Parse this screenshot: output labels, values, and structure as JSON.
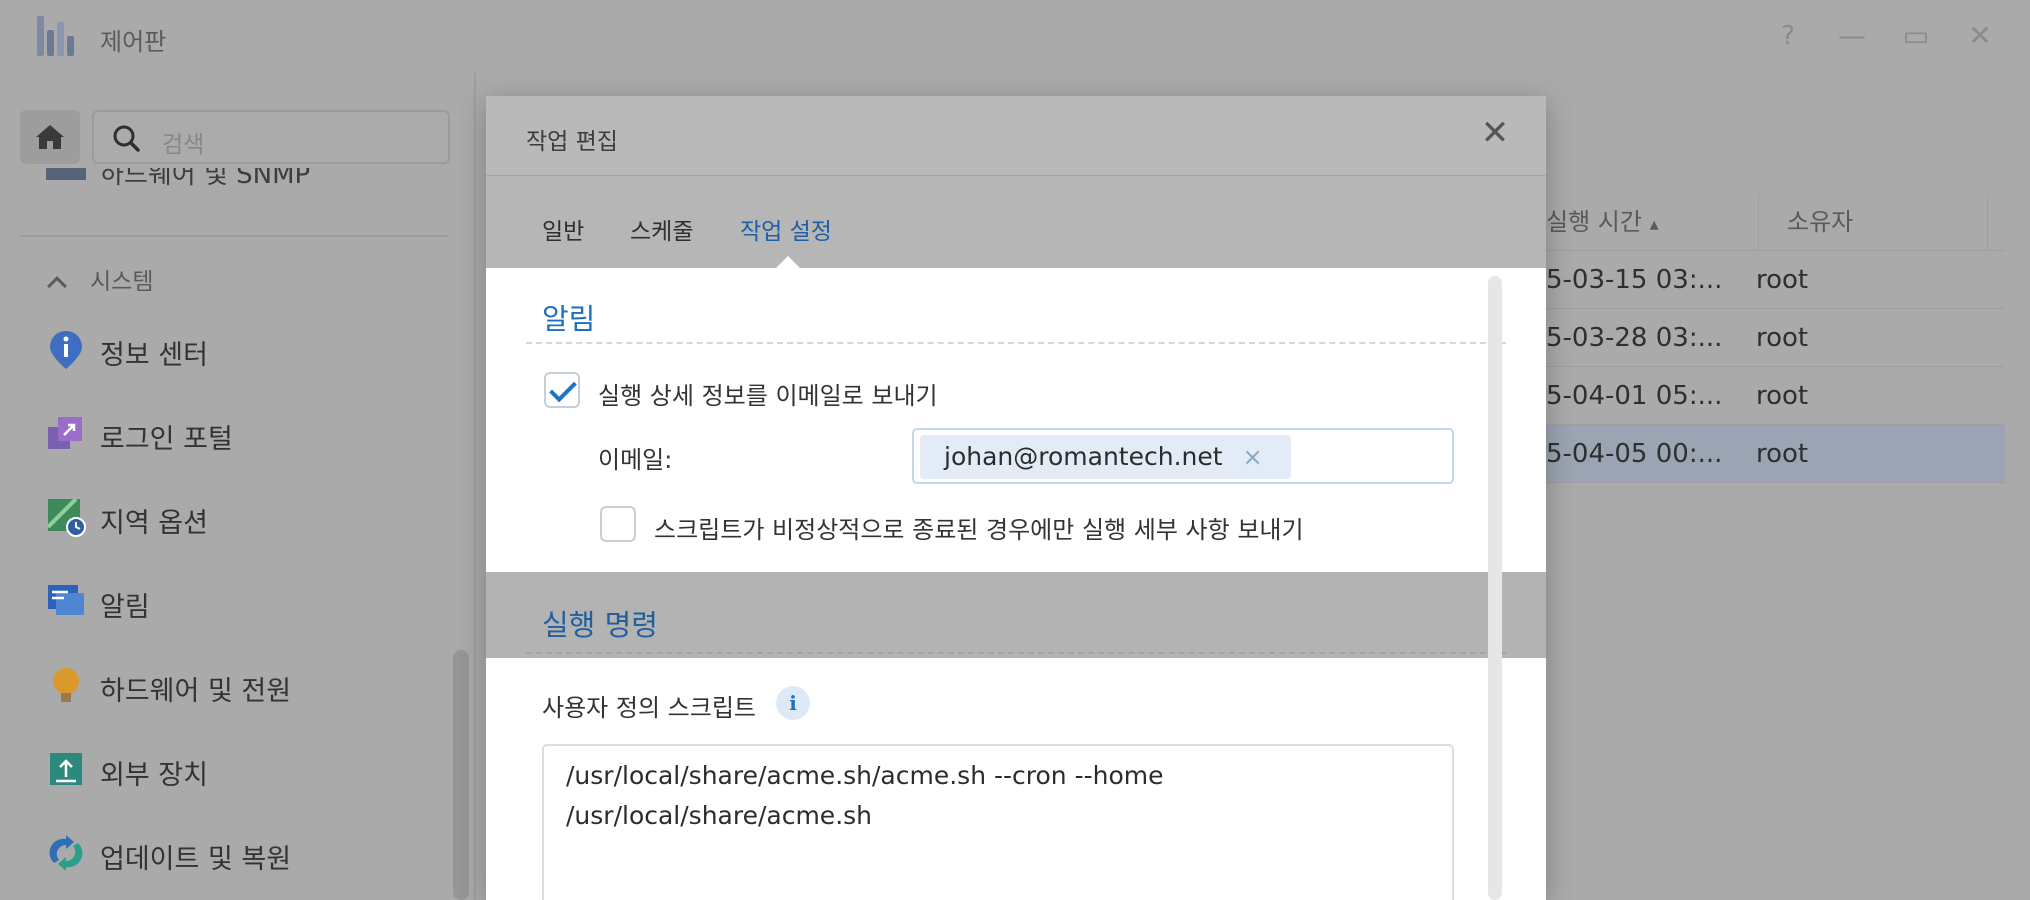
{
  "app": {
    "title": "제어판"
  },
  "window_controls": {
    "help": "?",
    "minimize": "—",
    "maximize": "▭",
    "close": "✕"
  },
  "sidebar": {
    "search_placeholder": "검색",
    "cut_item": "하드웨어 및 SNMP",
    "section": "시스템",
    "items": [
      {
        "label": "정보 센터",
        "icon": "info-pin-icon"
      },
      {
        "label": "로그인 포털",
        "icon": "login-portal-icon"
      },
      {
        "label": "지역 옵션",
        "icon": "regional-options-icon"
      },
      {
        "label": "알림",
        "icon": "notification-icon"
      },
      {
        "label": "하드웨어 및 전원",
        "icon": "hardware-power-icon"
      },
      {
        "label": "외부 장치",
        "icon": "external-devices-icon"
      },
      {
        "label": "업데이트 및 복원",
        "icon": "update-restore-icon"
      }
    ]
  },
  "table": {
    "columns": [
      "실행 시간",
      "소유자"
    ],
    "sort_indicator": "▴",
    "rows": [
      {
        "time": "5-03-15 03:...",
        "owner": "root"
      },
      {
        "time": "5-03-28 03:...",
        "owner": "root"
      },
      {
        "time": "5-04-01 05:...",
        "owner": "root"
      },
      {
        "time": "5-04-05 00:...",
        "owner": "root",
        "selected": true
      }
    ]
  },
  "modal": {
    "title": "작업 편집",
    "close": "✕",
    "tabs": [
      "일반",
      "스케줄",
      "작업 설정"
    ],
    "active_tab": "작업 설정",
    "notify": {
      "title": "알림",
      "send_email_label": "실행 상세 정보를 이메일로 보내기",
      "send_email_checked": true,
      "email_label": "이메일:",
      "email_value": "johan@romantech.net",
      "chip_remove": "×",
      "abnormal_only_label": "스크립트가 비정상적으로 종료된 경우에만 실행 세부 사항 보내기",
      "abnormal_only_checked": false
    },
    "command": {
      "title": "실행 명령",
      "script_label": "사용자 정의 스크립트",
      "info": "i",
      "script": "/usr/local/share/acme.sh/acme.sh --cron --home\n/usr/local/share/acme.sh"
    }
  }
}
